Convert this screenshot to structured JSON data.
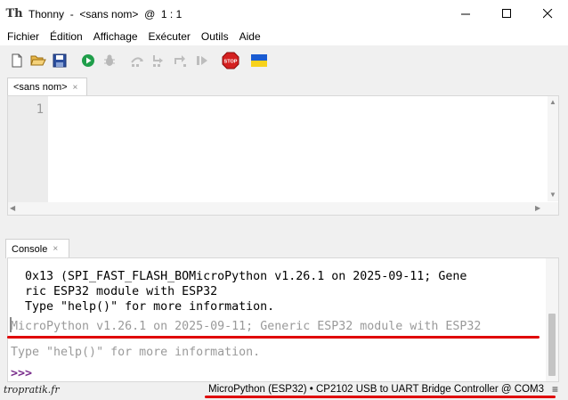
{
  "window": {
    "app_name": "Thonny",
    "title": "Thonny  -  <sans nom>  @  1 : 1"
  },
  "menu": {
    "items": [
      "Fichier",
      "Édition",
      "Affichage",
      "Exécuter",
      "Outils",
      "Aide"
    ]
  },
  "toolbar": {
    "buttons": [
      "new-file-icon",
      "open-file-icon",
      "save-file-icon",
      "run-icon",
      "debug-icon",
      "step-over-icon",
      "step-into-icon",
      "step-out-icon",
      "resume-icon",
      "stop-icon",
      "ukraine-flag-icon"
    ],
    "stop_label": "STOP"
  },
  "editor": {
    "tab_label": "<sans nom>",
    "tab_close": "×",
    "line_numbers": [
      "1"
    ]
  },
  "console": {
    "tab_label": "Console",
    "tab_close": "×",
    "lines_old": [
      "0x13 (SPI_FAST_FLASH_BOMicroPython v1.26.1 on 2025-09-11; Gene",
      "ric ESP32 module with ESP32",
      "Type \"help()\" for more information."
    ],
    "line_banner": "MicroPython v1.26.1 on 2025-09-11; Generic ESP32 module with ESP32",
    "line_help": "Type \"help()\" for more information.",
    "prompt": ">>>"
  },
  "statusbar": {
    "watermark": "tropratik.fr",
    "interpreter": "MicroPython (ESP32)  •  CP2102 USB to UART Bridge Controller @ COM3",
    "menu_glyph": "≡"
  },
  "colors": {
    "highlight_underline": "#e00000",
    "prompt": "#7a2e8c",
    "gray_text": "#9a9a9a"
  }
}
